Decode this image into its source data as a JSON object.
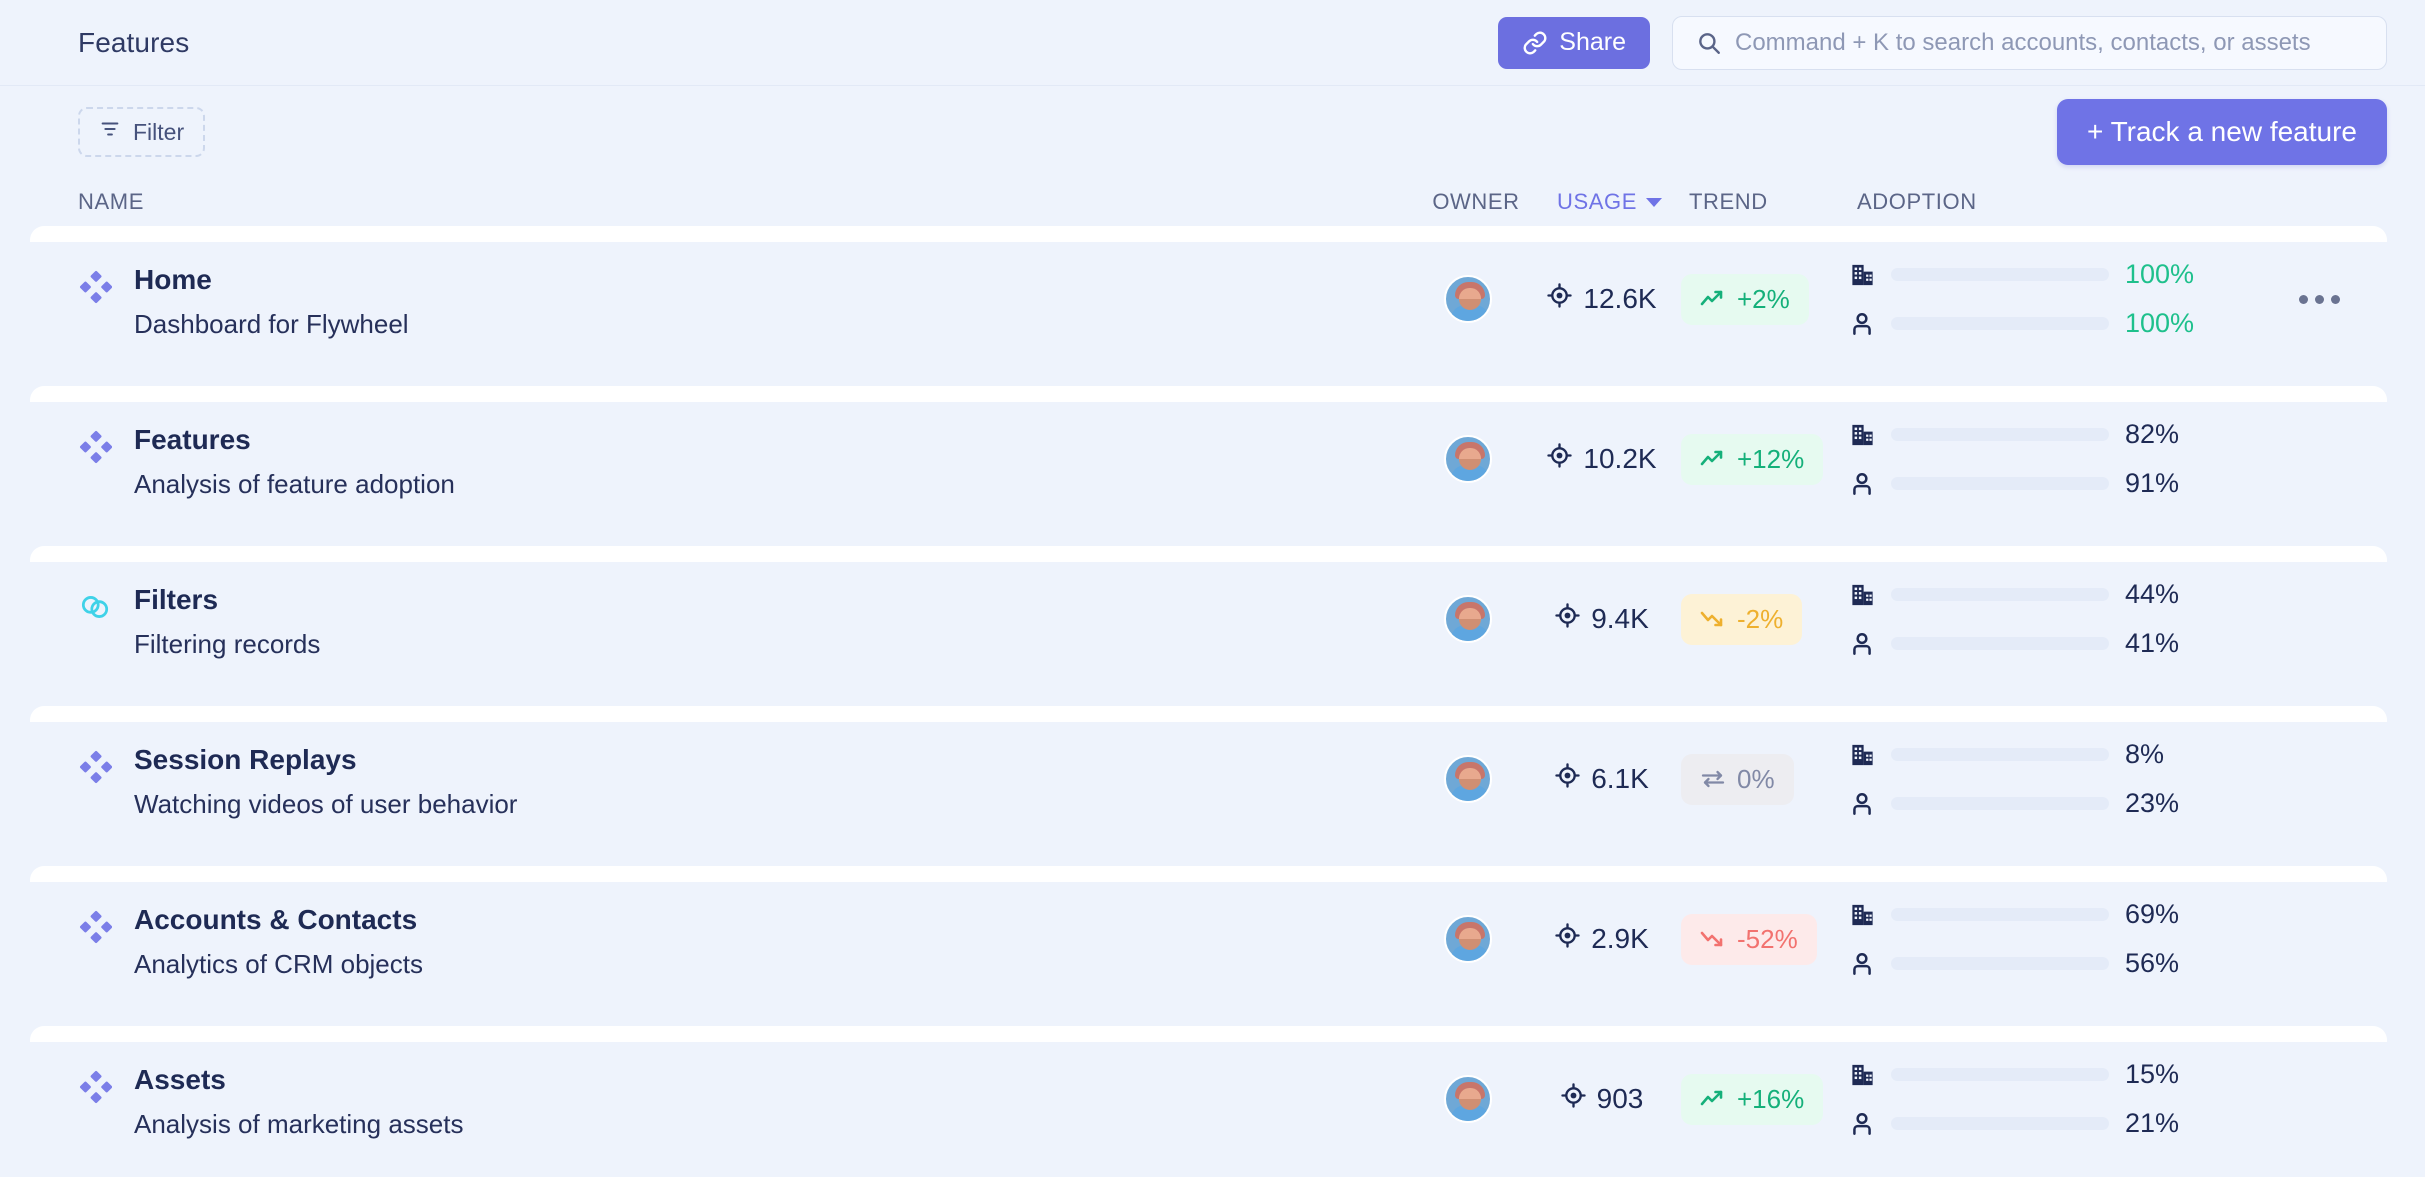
{
  "header": {
    "title": "Features",
    "share_label": "Share",
    "share_icon": "link-icon",
    "search_placeholder": "Command + K to search accounts, contacts, or assets",
    "search_value": "",
    "search_icon": "search-icon"
  },
  "toolbar": {
    "filter_label": "Filter",
    "filter_icon": "filter-icon",
    "track_label": "+ Track a new feature"
  },
  "columns": {
    "name": "NAME",
    "owner": "OWNER",
    "usage": "USAGE",
    "usage_sort_icon": "chevron-down-icon",
    "trend": "TREND",
    "adoption": "ADOPTION"
  },
  "colors": {
    "accent": "#6f73e6",
    "green": "#1ec08c",
    "red": "#f2726f",
    "yellow": "#eeb02e",
    "gray": "#8189a6",
    "cyan": "#3fd2e8",
    "navy": "#1e2a54",
    "page_bg": "#eef3fc"
  },
  "rows": [
    {
      "icon": "diamond-cluster-icon",
      "icon_color": "#7b7ee8",
      "name": "Home",
      "description": "Dashboard for Flywheel",
      "owner_avatar": "user-avatar",
      "usage": "12.6K",
      "usage_icon": "target-icon",
      "trend": "+2%",
      "trend_dir": "up",
      "trend_icon": "trend-up-icon",
      "adoption": [
        {
          "icon": "building-icon",
          "value": "100%",
          "pct": 100,
          "color": "green"
        },
        {
          "icon": "person-icon",
          "value": "100%",
          "pct": 100,
          "color": "green"
        }
      ],
      "has_more_menu": true,
      "more_icon": "ellipsis-icon"
    },
    {
      "icon": "diamond-cluster-icon",
      "icon_color": "#7b7ee8",
      "name": "Features",
      "description": "Analysis of feature adoption",
      "owner_avatar": "user-avatar",
      "usage": "10.2K",
      "usage_icon": "target-icon",
      "trend": "+12%",
      "trend_dir": "up",
      "trend_icon": "trend-up-icon",
      "adoption": [
        {
          "icon": "building-icon",
          "value": "82%",
          "pct": 82,
          "color": "purple"
        },
        {
          "icon": "person-icon",
          "value": "91%",
          "pct": 91,
          "color": "purple"
        }
      ],
      "has_more_menu": false,
      "more_icon": "ellipsis-icon"
    },
    {
      "icon": "venn-circles-icon",
      "icon_color": "#3fd2e8",
      "name": "Filters",
      "description": "Filtering records",
      "owner_avatar": "user-avatar",
      "usage": "9.4K",
      "usage_icon": "target-icon",
      "trend": "-2%",
      "trend_dir": "warn",
      "trend_icon": "trend-down-icon",
      "adoption": [
        {
          "icon": "building-icon",
          "value": "44%",
          "pct": 44,
          "color": "purple"
        },
        {
          "icon": "person-icon",
          "value": "41%",
          "pct": 41,
          "color": "purple"
        }
      ],
      "has_more_menu": false,
      "more_icon": "ellipsis-icon"
    },
    {
      "icon": "diamond-cluster-icon",
      "icon_color": "#7b7ee8",
      "name": "Session Replays",
      "description": "Watching videos of user behavior",
      "owner_avatar": "user-avatar",
      "usage": "6.1K",
      "usage_icon": "target-icon",
      "trend": "0%",
      "trend_dir": "flat",
      "trend_icon": "swap-arrows-icon",
      "adoption": [
        {
          "icon": "building-icon",
          "value": "8%",
          "pct": 8,
          "color": "purple"
        },
        {
          "icon": "person-icon",
          "value": "23%",
          "pct": 23,
          "color": "purple"
        }
      ],
      "has_more_menu": false,
      "more_icon": "ellipsis-icon"
    },
    {
      "icon": "diamond-cluster-icon",
      "icon_color": "#7b7ee8",
      "name": "Accounts & Contacts",
      "description": "Analytics of CRM objects",
      "owner_avatar": "user-avatar",
      "usage": "2.9K",
      "usage_icon": "target-icon",
      "trend": "-52%",
      "trend_dir": "down",
      "trend_icon": "trend-down-icon",
      "adoption": [
        {
          "icon": "building-icon",
          "value": "69%",
          "pct": 69,
          "color": "purple"
        },
        {
          "icon": "person-icon",
          "value": "56%",
          "pct": 56,
          "color": "purple"
        }
      ],
      "has_more_menu": false,
      "more_icon": "ellipsis-icon"
    },
    {
      "icon": "diamond-cluster-icon",
      "icon_color": "#7b7ee8",
      "name": "Assets",
      "description": "Analysis of marketing assets",
      "owner_avatar": "user-avatar",
      "usage": "903",
      "usage_icon": "target-icon",
      "trend": "+16%",
      "trend_dir": "up",
      "trend_icon": "trend-up-icon",
      "adoption": [
        {
          "icon": "building-icon",
          "value": "15%",
          "pct": 15,
          "color": "purple"
        },
        {
          "icon": "person-icon",
          "value": "21%",
          "pct": 21,
          "color": "purple"
        }
      ],
      "has_more_menu": false,
      "more_icon": "ellipsis-icon"
    }
  ]
}
